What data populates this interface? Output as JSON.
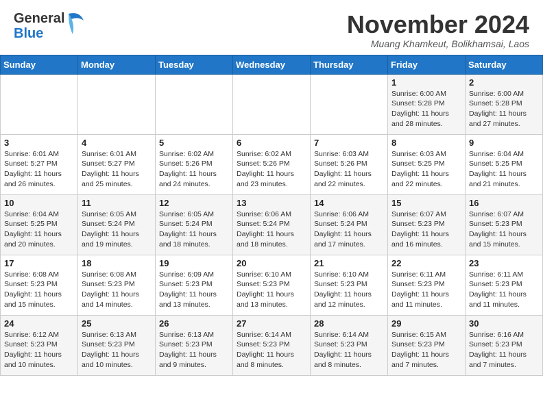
{
  "header": {
    "logo_general": "General",
    "logo_blue": "Blue",
    "month_title": "November 2024",
    "subtitle": "Muang Khamkeut, Bolikhamsai, Laos"
  },
  "weekdays": [
    "Sunday",
    "Monday",
    "Tuesday",
    "Wednesday",
    "Thursday",
    "Friday",
    "Saturday"
  ],
  "weeks": [
    [
      {
        "day": "",
        "info": ""
      },
      {
        "day": "",
        "info": ""
      },
      {
        "day": "",
        "info": ""
      },
      {
        "day": "",
        "info": ""
      },
      {
        "day": "",
        "info": ""
      },
      {
        "day": "1",
        "info": "Sunrise: 6:00 AM\nSunset: 5:28 PM\nDaylight: 11 hours\nand 28 minutes."
      },
      {
        "day": "2",
        "info": "Sunrise: 6:00 AM\nSunset: 5:28 PM\nDaylight: 11 hours\nand 27 minutes."
      }
    ],
    [
      {
        "day": "3",
        "info": "Sunrise: 6:01 AM\nSunset: 5:27 PM\nDaylight: 11 hours\nand 26 minutes."
      },
      {
        "day": "4",
        "info": "Sunrise: 6:01 AM\nSunset: 5:27 PM\nDaylight: 11 hours\nand 25 minutes."
      },
      {
        "day": "5",
        "info": "Sunrise: 6:02 AM\nSunset: 5:26 PM\nDaylight: 11 hours\nand 24 minutes."
      },
      {
        "day": "6",
        "info": "Sunrise: 6:02 AM\nSunset: 5:26 PM\nDaylight: 11 hours\nand 23 minutes."
      },
      {
        "day": "7",
        "info": "Sunrise: 6:03 AM\nSunset: 5:26 PM\nDaylight: 11 hours\nand 22 minutes."
      },
      {
        "day": "8",
        "info": "Sunrise: 6:03 AM\nSunset: 5:25 PM\nDaylight: 11 hours\nand 22 minutes."
      },
      {
        "day": "9",
        "info": "Sunrise: 6:04 AM\nSunset: 5:25 PM\nDaylight: 11 hours\nand 21 minutes."
      }
    ],
    [
      {
        "day": "10",
        "info": "Sunrise: 6:04 AM\nSunset: 5:25 PM\nDaylight: 11 hours\nand 20 minutes."
      },
      {
        "day": "11",
        "info": "Sunrise: 6:05 AM\nSunset: 5:24 PM\nDaylight: 11 hours\nand 19 minutes."
      },
      {
        "day": "12",
        "info": "Sunrise: 6:05 AM\nSunset: 5:24 PM\nDaylight: 11 hours\nand 18 minutes."
      },
      {
        "day": "13",
        "info": "Sunrise: 6:06 AM\nSunset: 5:24 PM\nDaylight: 11 hours\nand 18 minutes."
      },
      {
        "day": "14",
        "info": "Sunrise: 6:06 AM\nSunset: 5:24 PM\nDaylight: 11 hours\nand 17 minutes."
      },
      {
        "day": "15",
        "info": "Sunrise: 6:07 AM\nSunset: 5:23 PM\nDaylight: 11 hours\nand 16 minutes."
      },
      {
        "day": "16",
        "info": "Sunrise: 6:07 AM\nSunset: 5:23 PM\nDaylight: 11 hours\nand 15 minutes."
      }
    ],
    [
      {
        "day": "17",
        "info": "Sunrise: 6:08 AM\nSunset: 5:23 PM\nDaylight: 11 hours\nand 15 minutes."
      },
      {
        "day": "18",
        "info": "Sunrise: 6:08 AM\nSunset: 5:23 PM\nDaylight: 11 hours\nand 14 minutes."
      },
      {
        "day": "19",
        "info": "Sunrise: 6:09 AM\nSunset: 5:23 PM\nDaylight: 11 hours\nand 13 minutes."
      },
      {
        "day": "20",
        "info": "Sunrise: 6:10 AM\nSunset: 5:23 PM\nDaylight: 11 hours\nand 13 minutes."
      },
      {
        "day": "21",
        "info": "Sunrise: 6:10 AM\nSunset: 5:23 PM\nDaylight: 11 hours\nand 12 minutes."
      },
      {
        "day": "22",
        "info": "Sunrise: 6:11 AM\nSunset: 5:23 PM\nDaylight: 11 hours\nand 11 minutes."
      },
      {
        "day": "23",
        "info": "Sunrise: 6:11 AM\nSunset: 5:23 PM\nDaylight: 11 hours\nand 11 minutes."
      }
    ],
    [
      {
        "day": "24",
        "info": "Sunrise: 6:12 AM\nSunset: 5:23 PM\nDaylight: 11 hours\nand 10 minutes."
      },
      {
        "day": "25",
        "info": "Sunrise: 6:13 AM\nSunset: 5:23 PM\nDaylight: 11 hours\nand 10 minutes."
      },
      {
        "day": "26",
        "info": "Sunrise: 6:13 AM\nSunset: 5:23 PM\nDaylight: 11 hours\nand 9 minutes."
      },
      {
        "day": "27",
        "info": "Sunrise: 6:14 AM\nSunset: 5:23 PM\nDaylight: 11 hours\nand 8 minutes."
      },
      {
        "day": "28",
        "info": "Sunrise: 6:14 AM\nSunset: 5:23 PM\nDaylight: 11 hours\nand 8 minutes."
      },
      {
        "day": "29",
        "info": "Sunrise: 6:15 AM\nSunset: 5:23 PM\nDaylight: 11 hours\nand 7 minutes."
      },
      {
        "day": "30",
        "info": "Sunrise: 6:16 AM\nSunset: 5:23 PM\nDaylight: 11 hours\nand 7 minutes."
      }
    ]
  ]
}
